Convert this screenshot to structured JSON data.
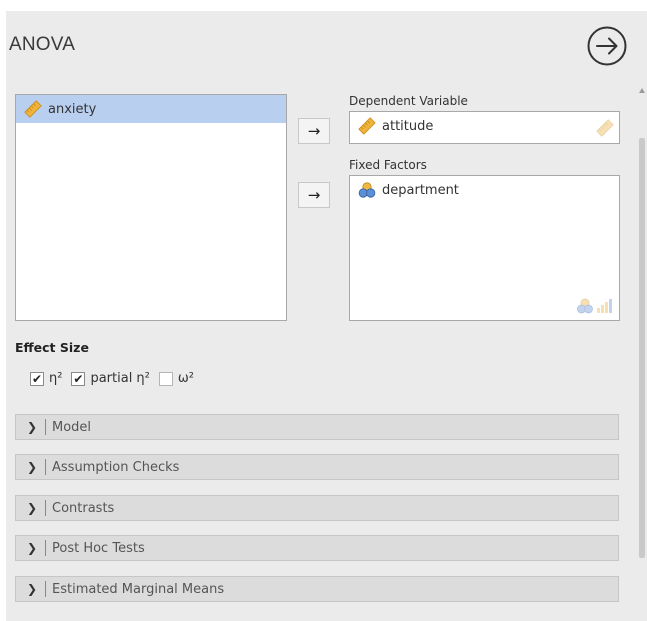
{
  "header": {
    "title": "ANOVA"
  },
  "source_list": {
    "items": [
      {
        "label": "anxiety",
        "icon": "continuous-scale-icon"
      }
    ]
  },
  "dependent_variable": {
    "label": "Dependent Variable",
    "value": "attitude",
    "icon": "continuous-scale-icon",
    "hint_icon": "continuous-scale-hint-icon"
  },
  "fixed_factors": {
    "label": "Fixed Factors",
    "items": [
      {
        "label": "department",
        "icon": "nominal-scale-icon"
      }
    ],
    "hint_icon": "nominal-ordinal-hint-icon"
  },
  "move_buttons": {
    "symbol": "→"
  },
  "effect_size": {
    "title": "Effect Size",
    "options": [
      {
        "label": "η²",
        "checked": true
      },
      {
        "label": "partial η²",
        "checked": true
      },
      {
        "label": "ω²",
        "checked": false
      }
    ]
  },
  "sections": [
    {
      "title": "Model"
    },
    {
      "title": "Assumption Checks"
    },
    {
      "title": "Contrasts"
    },
    {
      "title": "Post Hoc Tests"
    },
    {
      "title": "Estimated Marginal Means"
    }
  ],
  "colors": {
    "selected_row": "#b9cff0",
    "panel_bg": "#ebebeb",
    "scale_icon": "#f0b43c",
    "nominal_icon_a": "#f1b940",
    "nominal_icon_b": "#5d8fd6"
  }
}
